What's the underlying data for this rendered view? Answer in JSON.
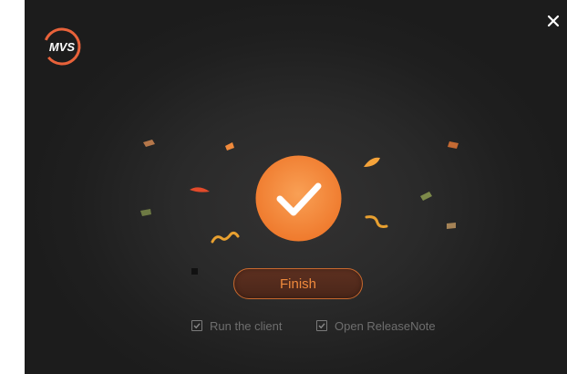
{
  "brand": {
    "logo_text": "MVS",
    "accent": "#f08a3c"
  },
  "icons": {
    "close": "close-icon",
    "check": "checkmark-icon",
    "checkbox": "checkbox-checked-icon"
  },
  "actions": {
    "finish_label": "Finish"
  },
  "options": [
    {
      "label": "Run the client",
      "checked": true
    },
    {
      "label": "Open ReleaseNote",
      "checked": true
    }
  ],
  "colors": {
    "background": "#1f1f1f",
    "accent": "#f08a3c",
    "muted_text": "#6e6e6e"
  }
}
